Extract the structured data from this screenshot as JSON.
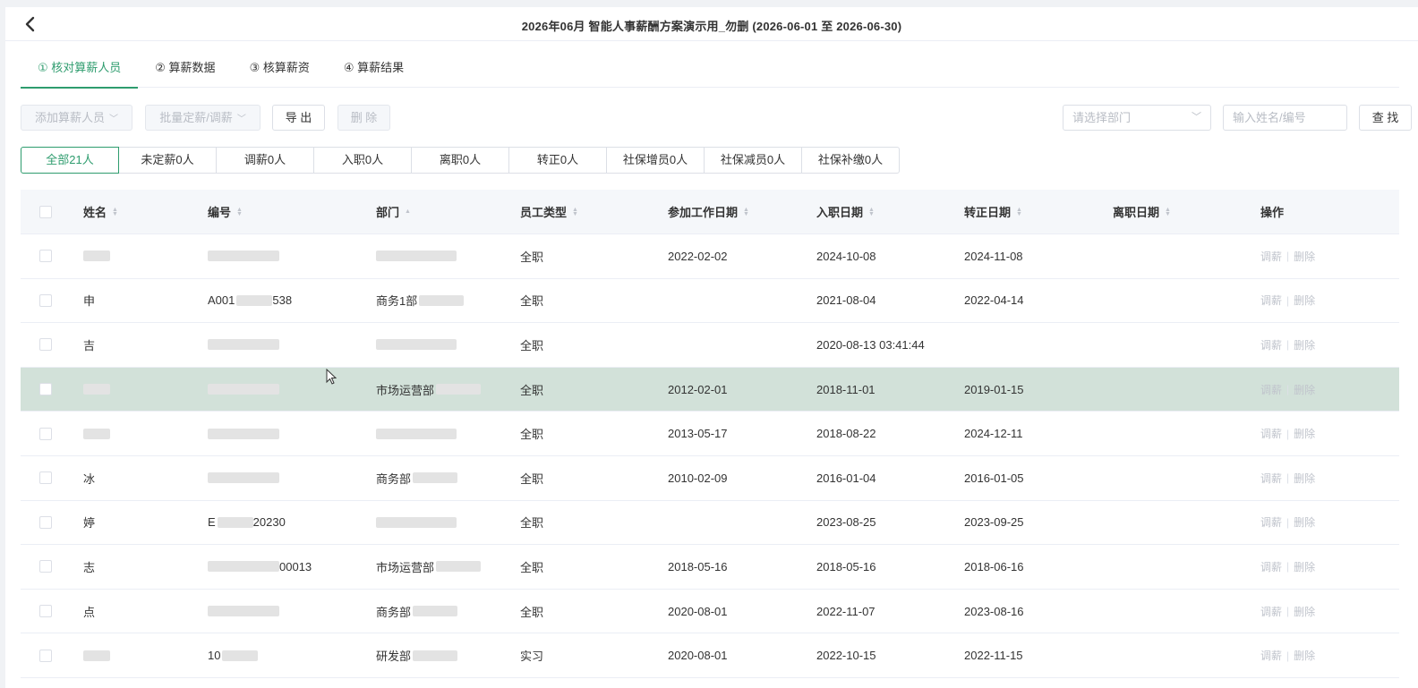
{
  "header": {
    "title": "2026年06月 智能人事薪酬方案演示用_勿删 (2026-06-01 至 2026-06-30)"
  },
  "steps": [
    {
      "label": "① 核对算薪人员",
      "active": true
    },
    {
      "label": "② 算薪数据",
      "active": false
    },
    {
      "label": "③ 核算薪资",
      "active": false
    },
    {
      "label": "④ 算薪结果",
      "active": false
    }
  ],
  "toolbar": {
    "add_label": "添加算薪人员",
    "batch_label": "批量定薪/调薪",
    "export_label": "导 出",
    "delete_label": "删 除",
    "dept_placeholder": "请选择部门",
    "search_placeholder": "输入姓名/编号",
    "search_label": "查 找"
  },
  "filters": [
    "全部21人",
    "未定薪0人",
    "调薪0人",
    "入职0人",
    "离职0人",
    "转正0人",
    "社保增员0人",
    "社保减员0人",
    "社保补缴0人"
  ],
  "columns": [
    "姓名",
    "编号",
    "部门",
    "员工类型",
    "参加工作日期",
    "入职日期",
    "转正日期",
    "离职日期",
    "操作"
  ],
  "rows": [
    {
      "name": "",
      "id": "",
      "dept": "",
      "type": "全职",
      "work_date": "2022-02-02",
      "join_date": "2024-10-08",
      "regular_date": "2024-11-08",
      "leave_date": ""
    },
    {
      "name": "申",
      "id": "A001",
      "id_suffix": "538",
      "dept": "商务1部",
      "type": "全职",
      "work_date": "",
      "join_date": "2021-08-04",
      "regular_date": "2022-04-14",
      "leave_date": ""
    },
    {
      "name": "吉",
      "id": "",
      "dept": "",
      "type": "全职",
      "work_date": "",
      "join_date": "2020-08-13 03:41:44",
      "regular_date": "",
      "leave_date": ""
    },
    {
      "name": "",
      "id": "",
      "dept": "市场运营部",
      "type": "全职",
      "work_date": "2012-02-01",
      "join_date": "2018-11-01",
      "regular_date": "2019-01-15",
      "leave_date": "",
      "highlight": true
    },
    {
      "name": "",
      "id": "",
      "dept": "",
      "type": "全职",
      "work_date": "2013-05-17",
      "join_date": "2018-08-22",
      "regular_date": "2024-12-11",
      "leave_date": ""
    },
    {
      "name": "冰",
      "id": "",
      "dept": "商务部",
      "type": "全职",
      "work_date": "2010-02-09",
      "join_date": "2016-01-04",
      "regular_date": "2016-01-05",
      "leave_date": ""
    },
    {
      "name": "婷",
      "id": "E",
      "id_suffix": "20230",
      "dept": "",
      "type": "全职",
      "work_date": "",
      "join_date": "2023-08-25",
      "regular_date": "2023-09-25",
      "leave_date": ""
    },
    {
      "name": "志",
      "id": "",
      "id_suffix": "00013",
      "dept": "市场运营部",
      "type": "全职",
      "work_date": "2018-05-16",
      "join_date": "2018-05-16",
      "regular_date": "2018-06-16",
      "leave_date": ""
    },
    {
      "name": "点",
      "id": "",
      "dept": "商务部",
      "type": "全职",
      "work_date": "2020-08-01",
      "join_date": "2022-11-07",
      "regular_date": "2023-08-16",
      "leave_date": ""
    },
    {
      "name": "",
      "id": "10",
      "dept": "研发部",
      "type": "实习",
      "work_date": "2020-08-01",
      "join_date": "2022-10-15",
      "regular_date": "2022-11-15",
      "leave_date": ""
    }
  ],
  "row_actions": {
    "adjust": "调薪",
    "delete": "删除"
  },
  "colors": {
    "accent": "#2e9c6e",
    "highlight_row": "#d2e1d9"
  }
}
